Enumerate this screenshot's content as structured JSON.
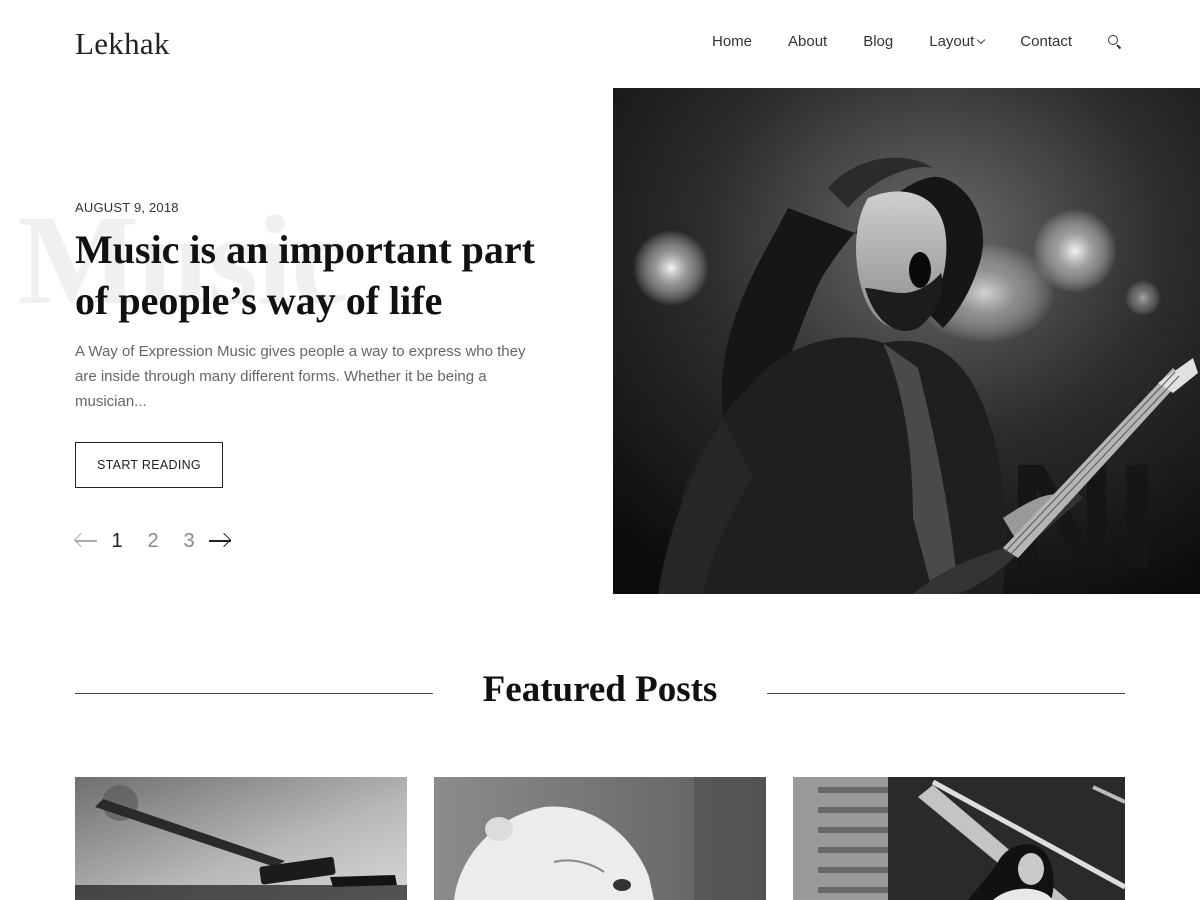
{
  "site": {
    "logo": "Lekhak"
  },
  "nav": {
    "items": [
      {
        "label": "Home"
      },
      {
        "label": "About"
      },
      {
        "label": "Blog"
      },
      {
        "label": "Layout"
      },
      {
        "label": "Contact"
      }
    ],
    "search_icon": "search-icon"
  },
  "hero": {
    "ghost_text": "Music",
    "date": "AUGUST 9, 2018",
    "title": "Music is an important part of people’s way of life",
    "excerpt": "A Way of Expression Music gives people a way to express who they are inside through many different forms. Whether it be being a musician...",
    "button_label": "START READING",
    "pagination": {
      "pages": [
        "1",
        "2",
        "3"
      ],
      "active": "1"
    }
  },
  "featured": {
    "title": "Featured Posts"
  },
  "colors": {
    "text": "#111111",
    "muted": "#666666",
    "line": "#3a4a55",
    "accent": "#222222"
  }
}
